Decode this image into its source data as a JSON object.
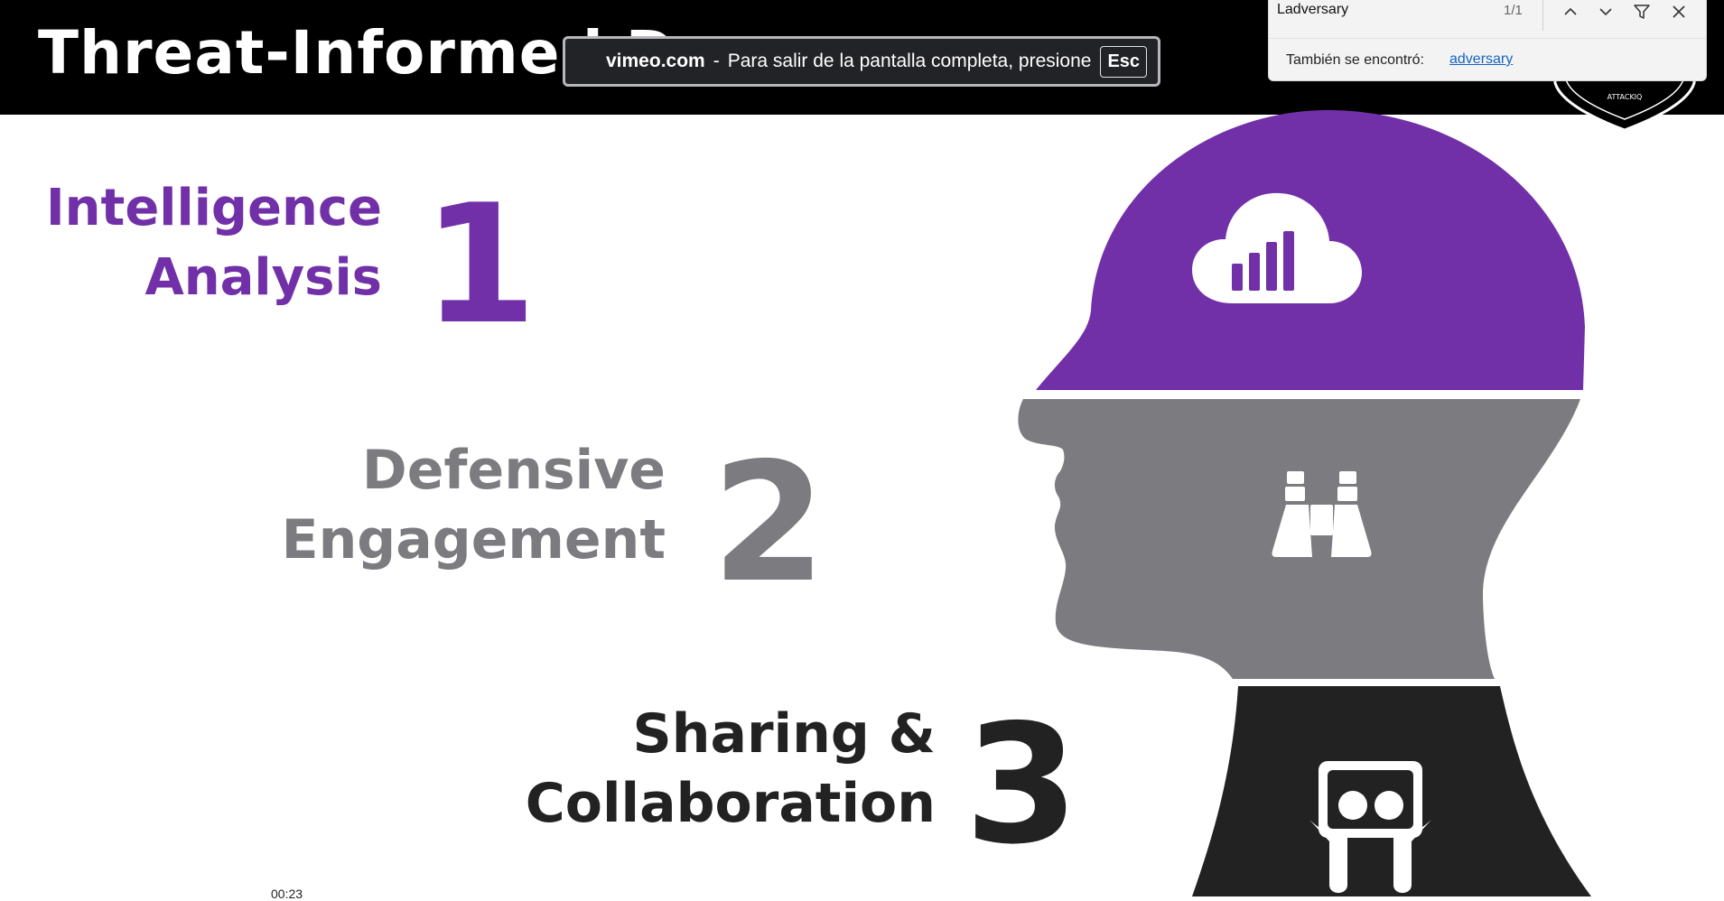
{
  "slide": {
    "title": "Threat-Informed D",
    "steps": [
      {
        "line1": "Intelligence",
        "line2": "Analysis",
        "number": "1",
        "color": "#7230a8"
      },
      {
        "line1": "Defensive",
        "line2": "Engagement",
        "number": "2",
        "color": "#7b7b80"
      },
      {
        "line1": "Sharing &",
        "line2": "Collaboration",
        "number": "3",
        "color": "#222222"
      }
    ],
    "icons": [
      "cloud-chart-icon",
      "binoculars-icon",
      "slideshare-icon"
    ],
    "logo_text": "ATTACKIQ"
  },
  "fullscreen_toast": {
    "domain": "vimeo.com",
    "separator": "-",
    "message": "Para salir de la pantalla completa, presione",
    "key": "Esc"
  },
  "find_bar": {
    "query": "Ladversary",
    "count": "1/1",
    "also_found_label": "También se encontró:",
    "also_found_link": "adversary"
  },
  "video": {
    "timestamp": "00:23"
  },
  "colors": {
    "purple": "#7230a8",
    "gray": "#7b7b80",
    "dark": "#222222",
    "black_bar": "#000000"
  }
}
